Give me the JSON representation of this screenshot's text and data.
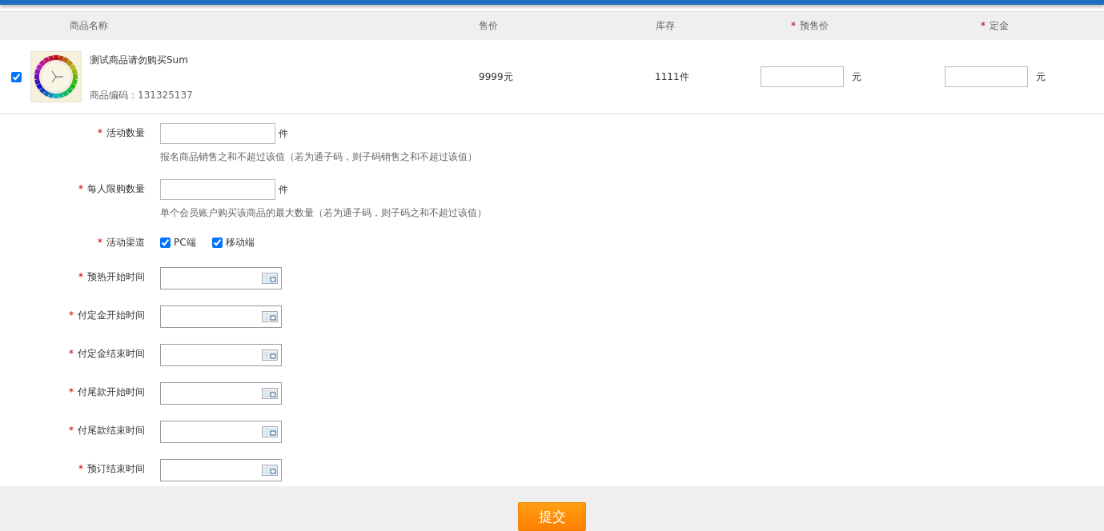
{
  "columns": [
    {
      "label": "商品名称"
    },
    {
      "label": "售价"
    },
    {
      "label": "库存"
    },
    {
      "label": "预售价",
      "mark": "*"
    },
    {
      "label": "定金",
      "mark": "*"
    }
  ],
  "product": {
    "checked": true,
    "name": "测试商品请勿购买Sum",
    "code": "商品编码：131325137",
    "price": "9999元",
    "stock": "1111件",
    "presale_unit": "元",
    "deposit_unit": "元"
  },
  "form": [
    {
      "kind": "number",
      "label": "活动数量",
      "mark": "*",
      "unit": "件",
      "hint": "报名商品销售之和不超过该值（若为通子码，则子码销售之和不超过该值）"
    },
    {
      "kind": "number",
      "label": "每人限购数量",
      "mark": "*",
      "unit": "件",
      "hint": "单个会员账户购买该商品的最大数量（若为通子码，则子码之和不超过该值）"
    },
    {
      "kind": "channels",
      "label": "活动渠道",
      "mark": "*",
      "options": [
        {
          "label": "PC端",
          "checked": true
        },
        {
          "label": "移动端",
          "checked": true
        }
      ]
    },
    {
      "kind": "date",
      "label": "预热开始时间",
      "mark": "*"
    },
    {
      "kind": "date",
      "label": "付定金开始时间",
      "mark": "*"
    },
    {
      "kind": "date",
      "label": "付定金结束时间",
      "mark": "*"
    },
    {
      "kind": "date",
      "label": "付尾款开始时间",
      "mark": "*"
    },
    {
      "kind": "date",
      "label": "付尾款结束时间",
      "mark": "*"
    },
    {
      "kind": "date",
      "label": "预订结束时间",
      "mark": "*"
    }
  ],
  "submit": "提交"
}
